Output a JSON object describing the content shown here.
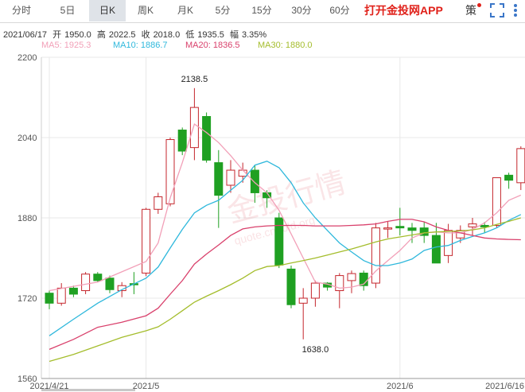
{
  "tabs": [
    {
      "label": "分时",
      "active": false
    },
    {
      "label": "5日",
      "active": false
    },
    {
      "label": "日K",
      "active": true
    },
    {
      "label": "周K",
      "active": false
    },
    {
      "label": "月K",
      "active": false
    },
    {
      "label": "5分",
      "active": false
    },
    {
      "label": "15分",
      "active": false
    },
    {
      "label": "30分",
      "active": false
    },
    {
      "label": "60分",
      "active": false
    }
  ],
  "promo_text": "打开金投网APP",
  "strategy_label": "策",
  "icons": {
    "fullscreen": "fullscreen-icon",
    "more": "more-icon"
  },
  "info": {
    "date": "2021/06/17",
    "open_label": "开",
    "open": "1950.0",
    "high_label": "高",
    "high": "2022.5",
    "close_label": "收",
    "close": "2018.0",
    "low_label": "低",
    "low": "1935.5",
    "amp_label": "幅",
    "amp": "3.35%"
  },
  "ma": [
    {
      "label": "MA5: 1925.3",
      "color": "#f2a0b8"
    },
    {
      "label": "MA10: 1886.7",
      "color": "#2fb8dc"
    },
    {
      "label": "MA20: 1836.5",
      "color": "#d9416c"
    },
    {
      "label": "MA30: 1880.0",
      "color": "#a4bd2c"
    }
  ],
  "watermark": {
    "text": "金投行情",
    "sub": "quote.cngold.org"
  },
  "colors": {
    "up": "#c4262c",
    "down": "#1fa022",
    "grid": "#e8e8e8",
    "axis": "#555555"
  },
  "chart_data": {
    "type": "candlestick",
    "ylim": [
      1560,
      2200
    ],
    "yticks": [
      2200,
      2040,
      1880,
      1720,
      1560
    ],
    "xticks": [
      {
        "label": "2021/4/21",
        "index": 0
      },
      {
        "label": "2021/5",
        "index": 8
      },
      {
        "label": "2021/6",
        "index": 29
      },
      {
        "label": "2021/6/16",
        "index": 41
      }
    ],
    "annotations": [
      {
        "text": "2138.5",
        "index": 12,
        "value": 2138.5
      },
      {
        "text": "1638.0",
        "index": 22,
        "value": 1638.0
      }
    ],
    "candles": [
      {
        "o": 1730,
        "h": 1735,
        "l": 1698,
        "c": 1710
      },
      {
        "o": 1710,
        "h": 1750,
        "l": 1705,
        "c": 1740
      },
      {
        "o": 1740,
        "h": 1745,
        "l": 1722,
        "c": 1728
      },
      {
        "o": 1735,
        "h": 1772,
        "l": 1728,
        "c": 1768
      },
      {
        "o": 1768,
        "h": 1772,
        "l": 1752,
        "c": 1755
      },
      {
        "o": 1760,
        "h": 1765,
        "l": 1730,
        "c": 1737
      },
      {
        "o": 1735,
        "h": 1752,
        "l": 1722,
        "c": 1745
      },
      {
        "o": 1749,
        "h": 1772,
        "l": 1728,
        "c": 1747
      },
      {
        "o": 1770,
        "h": 1900,
        "l": 1764,
        "c": 1897
      },
      {
        "o": 1897,
        "h": 1930,
        "l": 1888,
        "c": 1922
      },
      {
        "o": 1908,
        "h": 2040,
        "l": 1903,
        "c": 2036
      },
      {
        "o": 2055,
        "h": 2060,
        "l": 2005,
        "c": 2013
      },
      {
        "o": 2020,
        "h": 2138.5,
        "l": 1995,
        "c": 2100
      },
      {
        "o": 2082,
        "h": 2090,
        "l": 1990,
        "c": 1995
      },
      {
        "o": 1990,
        "h": 2015,
        "l": 1860,
        "c": 1925
      },
      {
        "o": 1945,
        "h": 1995,
        "l": 1930,
        "c": 1975
      },
      {
        "o": 1963,
        "h": 1990,
        "l": 1950,
        "c": 1975
      },
      {
        "o": 1975,
        "h": 1985,
        "l": 1910,
        "c": 1930
      },
      {
        "o": 1930,
        "h": 1935,
        "l": 1900,
        "c": 1920
      },
      {
        "o": 1880,
        "h": 1890,
        "l": 1780,
        "c": 1786
      },
      {
        "o": 1778,
        "h": 1785,
        "l": 1700,
        "c": 1707
      },
      {
        "o": 1710,
        "h": 1740,
        "l": 1638,
        "c": 1720
      },
      {
        "o": 1720,
        "h": 1755,
        "l": 1703,
        "c": 1750
      },
      {
        "o": 1750,
        "h": 1752,
        "l": 1735,
        "c": 1742
      },
      {
        "o": 1735,
        "h": 1770,
        "l": 1700,
        "c": 1765
      },
      {
        "o": 1755,
        "h": 1775,
        "l": 1730,
        "c": 1769
      },
      {
        "o": 1770,
        "h": 1775,
        "l": 1735,
        "c": 1745
      },
      {
        "o": 1750,
        "h": 1870,
        "l": 1740,
        "c": 1860
      },
      {
        "o": 1860,
        "h": 1872,
        "l": 1840,
        "c": 1860
      },
      {
        "o": 1863,
        "h": 1900,
        "l": 1845,
        "c": 1860
      },
      {
        "o": 1860,
        "h": 1870,
        "l": 1830,
        "c": 1855
      },
      {
        "o": 1860,
        "h": 1872,
        "l": 1830,
        "c": 1845
      },
      {
        "o": 1845,
        "h": 1870,
        "l": 1790,
        "c": 1790
      },
      {
        "o": 1805,
        "h": 1868,
        "l": 1790,
        "c": 1855
      },
      {
        "o": 1840,
        "h": 1865,
        "l": 1830,
        "c": 1855
      },
      {
        "o": 1862,
        "h": 1880,
        "l": 1845,
        "c": 1868
      },
      {
        "o": 1865,
        "h": 1872,
        "l": 1850,
        "c": 1862
      },
      {
        "o": 1865,
        "h": 1960,
        "l": 1860,
        "c": 1960
      },
      {
        "o": 1965,
        "h": 1970,
        "l": 1938,
        "c": 1955
      },
      {
        "o": 1950,
        "h": 2022.5,
        "l": 1935.5,
        "c": 2018
      }
    ],
    "series": [
      {
        "name": "MA5",
        "color": "#f2a0b8",
        "points": [
          [
            0,
            1735
          ],
          [
            4,
            1752
          ],
          [
            8,
            1793
          ],
          [
            9,
            1830
          ],
          [
            10,
            1920
          ],
          [
            11,
            1990
          ],
          [
            12,
            2067
          ],
          [
            13,
            2050
          ],
          [
            14,
            2030
          ],
          [
            15,
            2004
          ],
          [
            16,
            1975
          ],
          [
            17,
            1950
          ],
          [
            18,
            1930
          ],
          [
            19,
            1895
          ],
          [
            20,
            1848
          ],
          [
            21,
            1800
          ],
          [
            22,
            1752
          ],
          [
            23,
            1748
          ],
          [
            24,
            1740
          ],
          [
            25,
            1742
          ],
          [
            26,
            1748
          ],
          [
            27,
            1774
          ],
          [
            28,
            1795
          ],
          [
            29,
            1815
          ],
          [
            30,
            1840
          ],
          [
            31,
            1850
          ],
          [
            32,
            1852
          ],
          [
            33,
            1850
          ],
          [
            34,
            1850
          ],
          [
            35,
            1857
          ],
          [
            36,
            1870
          ],
          [
            37,
            1890
          ],
          [
            38,
            1915
          ],
          [
            39,
            1925.3
          ]
        ]
      },
      {
        "name": "MA10",
        "color": "#2fb8dc",
        "points": [
          [
            0,
            1645
          ],
          [
            2,
            1678
          ],
          [
            4,
            1710
          ],
          [
            6,
            1737
          ],
          [
            8,
            1760
          ],
          [
            9,
            1782
          ],
          [
            10,
            1820
          ],
          [
            11,
            1857
          ],
          [
            12,
            1890
          ],
          [
            13,
            1905
          ],
          [
            14,
            1915
          ],
          [
            15,
            1935
          ],
          [
            16,
            1955
          ],
          [
            17,
            1985
          ],
          [
            18,
            1993
          ],
          [
            19,
            1980
          ],
          [
            20,
            1950
          ],
          [
            21,
            1910
          ],
          [
            22,
            1880
          ],
          [
            23,
            1855
          ],
          [
            24,
            1830
          ],
          [
            25,
            1812
          ],
          [
            26,
            1795
          ],
          [
            27,
            1785
          ],
          [
            28,
            1785
          ],
          [
            29,
            1790
          ],
          [
            30,
            1798
          ],
          [
            31,
            1815
          ],
          [
            32,
            1822
          ],
          [
            33,
            1825
          ],
          [
            34,
            1835
          ],
          [
            35,
            1843
          ],
          [
            36,
            1850
          ],
          [
            37,
            1860
          ],
          [
            38,
            1875
          ],
          [
            39,
            1886.7
          ]
        ]
      },
      {
        "name": "MA20",
        "color": "#d9416c",
        "points": [
          [
            0,
            1618
          ],
          [
            2,
            1638
          ],
          [
            3,
            1650
          ],
          [
            4,
            1662
          ],
          [
            6,
            1672
          ],
          [
            8,
            1685
          ],
          [
            9,
            1700
          ],
          [
            10,
            1728
          ],
          [
            11,
            1755
          ],
          [
            12,
            1788
          ],
          [
            13,
            1808
          ],
          [
            14,
            1826
          ],
          [
            15,
            1845
          ],
          [
            16,
            1858
          ],
          [
            17,
            1862
          ],
          [
            18,
            1864
          ],
          [
            19,
            1865
          ],
          [
            20,
            1865
          ],
          [
            21,
            1865
          ],
          [
            22,
            1864
          ],
          [
            23,
            1864
          ],
          [
            24,
            1864
          ],
          [
            25,
            1865
          ],
          [
            26,
            1866
          ],
          [
            27,
            1868
          ],
          [
            28,
            1873
          ],
          [
            29,
            1877
          ],
          [
            30,
            1877
          ],
          [
            31,
            1872
          ],
          [
            32,
            1862
          ],
          [
            33,
            1855
          ],
          [
            34,
            1850
          ],
          [
            35,
            1845
          ],
          [
            36,
            1840
          ],
          [
            37,
            1838
          ],
          [
            38,
            1837
          ],
          [
            39,
            1836.5
          ]
        ]
      },
      {
        "name": "MA30",
        "color": "#a4bd2c",
        "points": [
          [
            0,
            1594
          ],
          [
            2,
            1608
          ],
          [
            4,
            1625
          ],
          [
            6,
            1642
          ],
          [
            8,
            1655
          ],
          [
            9,
            1663
          ],
          [
            10,
            1678
          ],
          [
            11,
            1695
          ],
          [
            12,
            1712
          ],
          [
            13,
            1724
          ],
          [
            14,
            1735
          ],
          [
            15,
            1747
          ],
          [
            16,
            1760
          ],
          [
            17,
            1775
          ],
          [
            18,
            1783
          ],
          [
            19,
            1785
          ],
          [
            20,
            1790
          ],
          [
            21,
            1795
          ],
          [
            22,
            1800
          ],
          [
            23,
            1806
          ],
          [
            24,
            1812
          ],
          [
            25,
            1818
          ],
          [
            26,
            1825
          ],
          [
            27,
            1832
          ],
          [
            28,
            1838
          ],
          [
            29,
            1842
          ],
          [
            30,
            1846
          ],
          [
            31,
            1850
          ],
          [
            32,
            1852
          ],
          [
            33,
            1853
          ],
          [
            34,
            1854
          ],
          [
            35,
            1856
          ],
          [
            36,
            1860
          ],
          [
            37,
            1867
          ],
          [
            38,
            1873
          ],
          [
            39,
            1880.0
          ]
        ]
      }
    ]
  }
}
